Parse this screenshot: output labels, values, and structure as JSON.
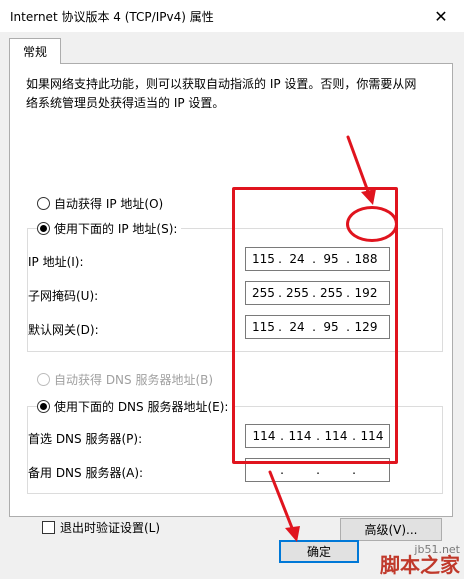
{
  "window": {
    "title": "Internet 协议版本 4 (TCP/IPv4) 属性",
    "close_glyph": "✕"
  },
  "tabs": [
    {
      "label": "常规",
      "selected": true
    }
  ],
  "description": {
    "line1": "如果网络支持此功能，则可以获取自动指派的 IP 设置。否则，你需要从网",
    "line2": "络系统管理员处获得适当的 IP 设置。"
  },
  "ip_mode": {
    "auto_label": "自动获得 IP 地址(O)",
    "auto_selected": false,
    "manual_label": "使用下面的 IP 地址(S):",
    "manual_selected": true
  },
  "ip_fields": [
    {
      "label": "IP 地址(I):",
      "octets": [
        "115",
        "24",
        "95",
        "188"
      ]
    },
    {
      "label": "子网掩码(U):",
      "octets": [
        "255",
        "255",
        "255",
        "192"
      ]
    },
    {
      "label": "默认网关(D):",
      "octets": [
        "115",
        "24",
        "95",
        "129"
      ]
    }
  ],
  "dns_mode": {
    "auto_label": "自动获得 DNS 服务器地址(B)",
    "auto_selected": false,
    "auto_disabled": true,
    "manual_label": "使用下面的 DNS 服务器地址(E):",
    "manual_selected": true
  },
  "dns_fields": [
    {
      "label": "首选 DNS 服务器(P):",
      "octets": [
        "114",
        "114",
        "114",
        "114"
      ]
    },
    {
      "label": "备用 DNS 服务器(A):",
      "octets": [
        "",
        "",
        "",
        ""
      ]
    }
  ],
  "validate_label": "退出时验证设置(L)",
  "validate_checked": false,
  "advanced_label": "高级(V)...",
  "ok_label": "确定",
  "annotation_color": "#e0141e",
  "watermark": {
    "url": "jb51.net",
    "cn": "脚本之家"
  }
}
